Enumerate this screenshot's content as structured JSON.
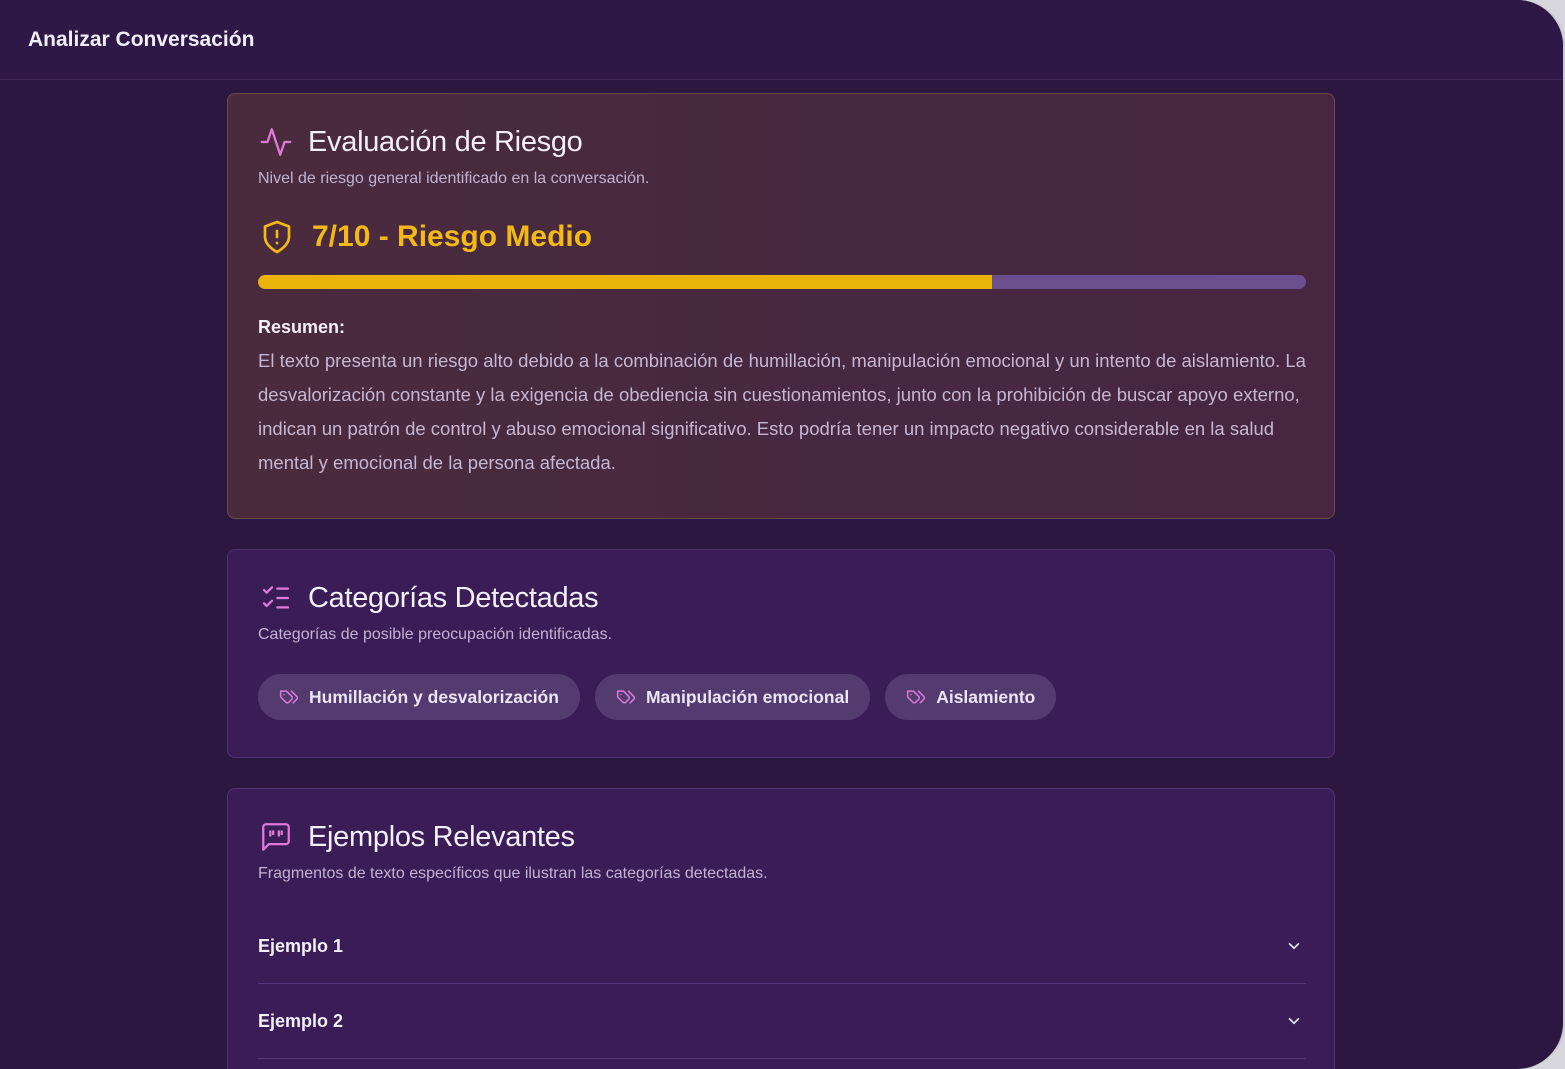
{
  "app": {
    "title": "Analizar Conversación"
  },
  "risk": {
    "heading": "Evaluación de Riesgo",
    "subtitle": "Nivel de riesgo general identificado en la conversación.",
    "score_text": "7/10 - Riesgo Medio",
    "score_fraction": 0.7,
    "summary_label": "Resumen:",
    "summary_text": "El texto presenta un riesgo alto debido a la combinación de humillación, manipulación emocional y un intento de aislamiento. La desvalorización constante y la exigencia de obediencia sin cuestionamientos, junto con la prohibición de buscar apoyo externo, indican un patrón de control y abuso emocional significativo. Esto podría tener un impacto negativo considerable en la salud mental y emocional de la persona afectada.",
    "accent_color": "#f4b914",
    "icons": {
      "heading": "activity-icon",
      "score": "shield-alert-icon"
    }
  },
  "categories": {
    "heading": "Categorías Detectadas",
    "subtitle": "Categorías de posible preocupación identificadas.",
    "items": [
      {
        "label": "Humillación y desvalorización",
        "icon": "tag-icon"
      },
      {
        "label": "Manipulación emocional",
        "icon": "tag-icon"
      },
      {
        "label": "Aislamiento",
        "icon": "tag-icon"
      }
    ],
    "icons": {
      "heading": "list-checks-icon"
    }
  },
  "examples": {
    "heading": "Ejemplos Relevantes",
    "subtitle": "Fragmentos de texto específicos que ilustran las categorías detectadas.",
    "items": [
      {
        "label": "Ejemplo 1"
      },
      {
        "label": "Ejemplo 2"
      }
    ],
    "icons": {
      "heading": "message-quote-icon",
      "toggle": "chevron-down-icon"
    }
  }
}
